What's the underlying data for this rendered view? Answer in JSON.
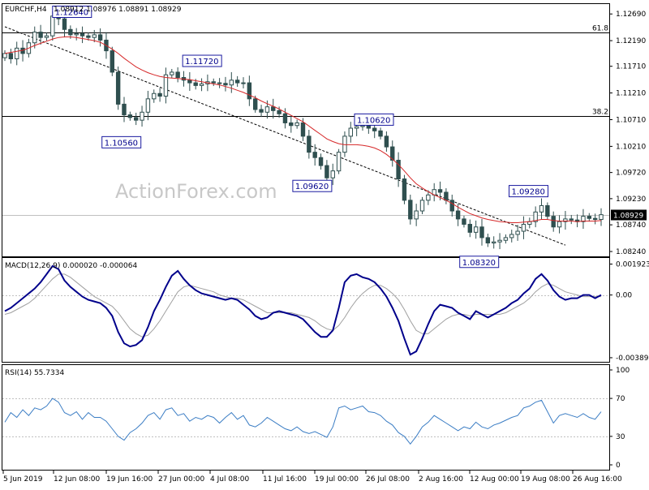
{
  "header": {
    "symbol": "EURCHF,H4",
    "ohlc": "1.08912 1.08976 1.08891 1.08929"
  },
  "watermark": "ActionForex.com",
  "colors": {
    "candle": "#2f4f4f",
    "ema": "#d62728",
    "macd": "#00008b",
    "signal": "#a0a0a0",
    "rsi": "#3b7dc4",
    "callout_border": "#1a1aa0",
    "price_tag": "#000000"
  },
  "chart_data": [
    {
      "type": "candlestick",
      "name": "price",
      "ylim": [
        1.0821,
        1.1283
      ],
      "y_ticks": [
        "1.12690",
        "1.12190",
        "1.11710",
        "1.11210",
        "1.10710",
        "1.10210",
        "1.09720",
        "1.09230",
        "1.08740",
        "1.08240"
      ],
      "current_price": "1.08929",
      "fib_levels": [
        {
          "label": "61.8",
          "value": 1.1234
        },
        {
          "label": "38.2",
          "value": 1.1078
        }
      ],
      "annotations": [
        {
          "label": "1.12640",
          "value": 1.1264
        },
        {
          "label": "1.11720",
          "value": 1.1172
        },
        {
          "label": "1.10560",
          "value": 1.1056
        },
        {
          "label": "1.10620",
          "value": 1.1062
        },
        {
          "label": "1.09620",
          "value": 1.0962
        },
        {
          "label": "1.09280",
          "value": 1.0928
        },
        {
          "label": "1.08320",
          "value": 1.0832
        }
      ],
      "trendline": [
        [
          0,
          1.1245
        ],
        [
          94,
          1.0836
        ]
      ],
      "closes": [
        1.1195,
        1.1185,
        1.1205,
        1.1195,
        1.1215,
        1.1235,
        1.1225,
        1.1228,
        1.1265,
        1.126,
        1.124,
        1.123,
        1.1232,
        1.1228,
        1.1225,
        1.123,
        1.122,
        1.12,
        1.116,
        1.11,
        1.108,
        1.1075,
        1.107,
        1.1085,
        1.111,
        1.112,
        1.1115,
        1.1155,
        1.116,
        1.115,
        1.1145,
        1.114,
        1.1135,
        1.1138,
        1.1142,
        1.114,
        1.1139,
        1.1136,
        1.1145,
        1.114,
        1.114,
        1.111,
        1.109,
        1.1085,
        1.1095,
        1.1088,
        1.1082,
        1.1065,
        1.106,
        1.1065,
        1.104,
        1.101,
        1.1,
        1.0985,
        1.0962,
        1.0975,
        1.101,
        1.104,
        1.1055,
        1.1058,
        1.106,
        1.1055,
        1.105,
        1.104,
        1.102,
        1.0995,
        1.096,
        1.092,
        1.0885,
        1.09,
        1.092,
        1.093,
        1.094,
        1.0935,
        1.092,
        1.09,
        1.0885,
        1.0875,
        1.086,
        1.087,
        1.085,
        1.084,
        1.0842,
        1.0845,
        1.085,
        1.0856,
        1.0862,
        1.0875,
        1.088,
        1.0898,
        1.091,
        1.089,
        1.087,
        1.088,
        1.0885,
        1.0883,
        1.088,
        1.089,
        1.0886,
        1.0884,
        1.0893
      ],
      "ema": [
        1.1195,
        1.1197,
        1.1199,
        1.1201,
        1.1205,
        1.121,
        1.1214,
        1.1218,
        1.1222,
        1.1225,
        1.1226,
        1.1226,
        1.1225,
        1.1223,
        1.1221,
        1.1219,
        1.1216,
        1.121,
        1.1203,
        1.1195,
        1.1186,
        1.1178,
        1.117,
        1.1164,
        1.1159,
        1.1155,
        1.1152,
        1.115,
        1.1149,
        1.1148,
        1.1147,
        1.1146,
        1.1144,
        1.1142,
        1.114,
        1.1138,
        1.1136,
        1.1133,
        1.113,
        1.1126,
        1.1122,
        1.1117,
        1.1112,
        1.1106,
        1.1101,
        1.1096,
        1.1091,
        1.1085,
        1.1079,
        1.1073,
        1.1067,
        1.1059,
        1.1051,
        1.1043,
        1.1035,
        1.103,
        1.1026,
        1.1024,
        1.1024,
        1.1024,
        1.1023,
        1.1021,
        1.1018,
        1.1013,
        1.1006,
        1.0997,
        1.0987,
        1.0975,
        1.0962,
        1.0951,
        1.0943,
        1.0936,
        1.093,
        1.0925,
        1.092,
        1.0914,
        1.0907,
        1.0901,
        1.0895,
        1.0891,
        1.0887,
        1.0884,
        1.0882,
        1.088,
        1.0879,
        1.0878,
        1.0878,
        1.0879,
        1.088,
        1.0882,
        1.0884,
        1.0884,
        1.0882,
        1.0881,
        1.0881,
        1.0881,
        1.088,
        1.0881,
        1.0881,
        1.0881,
        1.0882
      ]
    },
    {
      "type": "line",
      "name": "MACD(12,26,9) 0.000020 -0.000064",
      "ylim": [
        -0.00405,
        0.0022
      ],
      "y_ticks": [
        "0.001923",
        "0.00",
        "-0.003896"
      ],
      "macd": [
        -0.001,
        -0.0008,
        -0.0005,
        -0.0002,
        0.0001,
        0.0004,
        0.0008,
        0.0013,
        0.0018,
        0.0016,
        0.0009,
        0.0005,
        0.0002,
        -0.0001,
        -0.0003,
        -0.0004,
        -0.0005,
        -0.0008,
        -0.0013,
        -0.0023,
        -0.003,
        -0.0032,
        -0.0031,
        -0.0028,
        -0.002,
        -0.001,
        -0.0003,
        0.0005,
        0.0012,
        0.0015,
        0.001,
        0.0006,
        0.0003,
        0.0001,
        0.0,
        -0.0001,
        -0.0002,
        -0.0003,
        -0.0002,
        -0.0003,
        -0.0006,
        -0.0009,
        -0.0013,
        -0.0015,
        -0.0014,
        -0.0011,
        -0.001,
        -0.0011,
        -0.0012,
        -0.0013,
        -0.0015,
        -0.0019,
        -0.0023,
        -0.0026,
        -0.0026,
        -0.0022,
        -0.0008,
        0.0008,
        0.0012,
        0.0013,
        0.0011,
        0.001,
        0.0008,
        0.0004,
        -0.0001,
        -0.0008,
        -0.0016,
        -0.0027,
        -0.0037,
        -0.0035,
        -0.0027,
        -0.0018,
        -0.001,
        -0.0006,
        -0.0007,
        -0.0008,
        -0.0011,
        -0.0013,
        -0.0015,
        -0.001,
        -0.0012,
        -0.0014,
        -0.0012,
        -0.001,
        -0.0008,
        -0.0005,
        -0.0003,
        0.0001,
        0.0004,
        0.001,
        0.0013,
        0.0009,
        0.0003,
        -0.0001,
        -0.0003,
        -0.0002,
        -0.0002,
        0.0,
        0.0,
        -0.0002,
        0.0
      ],
      "signal": [
        -0.0012,
        -0.0011,
        -0.0009,
        -0.0007,
        -0.0005,
        -0.0002,
        0.0002,
        0.0006,
        0.001,
        0.0013,
        0.0013,
        0.0011,
        0.0008,
        0.0005,
        0.0002,
        -0.0001,
        -0.0003,
        -0.0005,
        -0.0007,
        -0.0011,
        -0.0016,
        -0.0021,
        -0.0024,
        -0.0026,
        -0.0025,
        -0.0021,
        -0.0016,
        -0.001,
        -0.0004,
        0.0002,
        0.0005,
        0.0006,
        0.0005,
        0.0004,
        0.0003,
        0.0002,
        0.0,
        -0.0001,
        -0.0002,
        -0.0002,
        -0.0003,
        -0.0005,
        -0.0007,
        -0.0009,
        -0.0011,
        -0.0011,
        -0.0011,
        -0.0011,
        -0.0011,
        -0.0012,
        -0.0013,
        -0.0014,
        -0.0016,
        -0.0019,
        -0.0021,
        -0.0022,
        -0.0019,
        -0.0014,
        -0.0008,
        -0.0003,
        0.0001,
        0.0004,
        0.0006,
        0.0006,
        0.0004,
        0.0001,
        -0.0003,
        -0.0009,
        -0.0016,
        -0.0022,
        -0.0024,
        -0.0024,
        -0.0021,
        -0.0018,
        -0.0015,
        -0.0013,
        -0.0012,
        -0.0012,
        -0.0013,
        -0.0012,
        -0.0012,
        -0.0012,
        -0.0012,
        -0.0012,
        -0.0011,
        -0.0009,
        -0.0007,
        -0.0005,
        -0.0002,
        0.0002,
        0.0005,
        0.0007,
        0.0006,
        0.0004,
        0.0002,
        0.0001,
        0.0,
        -0.0001,
        -0.0001,
        -0.0001,
        -0.0001
      ]
    },
    {
      "type": "line",
      "name": "RSI(14) 55.7334",
      "ylim": [
        0,
        100
      ],
      "y_ticks": [
        {
          "label": "100",
          "value": 100
        },
        {
          "label": "70",
          "value": 70
        },
        {
          "label": "30",
          "value": 30
        },
        {
          "label": "0",
          "value": 0
        }
      ],
      "levels": [
        70,
        30
      ],
      "values": [
        45,
        55,
        50,
        58,
        52,
        60,
        58,
        62,
        70,
        66,
        55,
        52,
        56,
        48,
        55,
        50,
        50,
        46,
        38,
        30,
        26,
        34,
        38,
        44,
        52,
        55,
        48,
        58,
        60,
        52,
        54,
        46,
        50,
        48,
        52,
        50,
        44,
        50,
        55,
        48,
        52,
        42,
        40,
        44,
        50,
        46,
        42,
        38,
        36,
        40,
        35,
        33,
        35,
        32,
        29,
        40,
        60,
        62,
        58,
        60,
        62,
        56,
        55,
        52,
        46,
        42,
        34,
        30,
        22,
        30,
        40,
        45,
        52,
        48,
        44,
        40,
        36,
        40,
        38,
        45,
        40,
        38,
        42,
        44,
        47,
        50,
        52,
        60,
        62,
        66,
        68,
        56,
        44,
        52,
        54,
        52,
        50,
        54,
        50,
        48,
        56
      ],
      "x_ticks": [
        "5 Jun 2019",
        "12 Jun 08:00",
        "19 Jun 16:00",
        "27 Jun 00:00",
        "4 Jul 08:00",
        "11 Jul 16:00",
        "19 Jul 00:00",
        "26 Jul 08:00",
        "2 Aug 16:00",
        "12 Aug 00:00",
        "19 Aug 08:00",
        "26 Aug 16:00"
      ]
    }
  ]
}
